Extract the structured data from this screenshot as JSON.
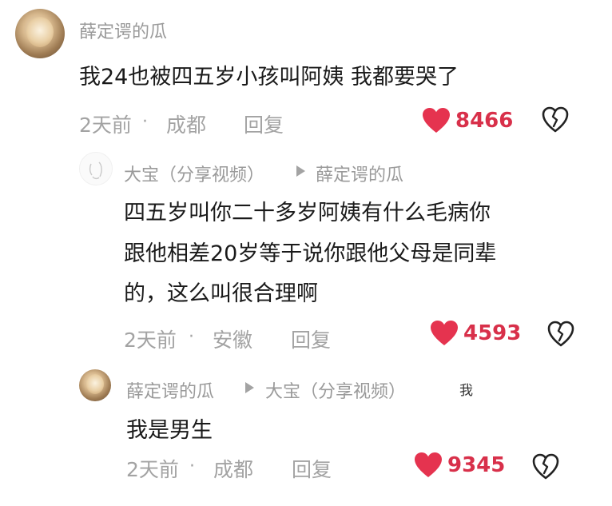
{
  "comments": [
    {
      "author": "薛定谔的瓜",
      "text": "我24也被四五岁小孩叫阿姨 我都要哭了",
      "time": "2天前",
      "location": "成都",
      "reply_label": "回复",
      "likes": "8466"
    },
    {
      "author": "大宝（分享视频）",
      "reply_to": "薛定谔的瓜",
      "text_lines": [
        "四五岁叫你二十多岁阿姨有什么毛病你",
        "跟他相差20岁等于说你跟他父母是同辈",
        "的，这么叫很合理啊"
      ],
      "time": "2天前",
      "location": "安徽",
      "reply_label": "回复",
      "likes": "4593"
    },
    {
      "author": "薛定谔的瓜",
      "reply_to": "大宝（分享视频）",
      "tag": "我",
      "text": "我是男生",
      "time": "2天前",
      "location": "成都",
      "reply_label": "回复",
      "likes": "9345"
    }
  ],
  "separator": "·",
  "icons": {
    "like": "heart-icon",
    "dislike": "broken-heart-icon",
    "arrow": "play-arrow-icon"
  },
  "colors": {
    "like": "#e5334f",
    "muted": "#a3a3a3"
  }
}
